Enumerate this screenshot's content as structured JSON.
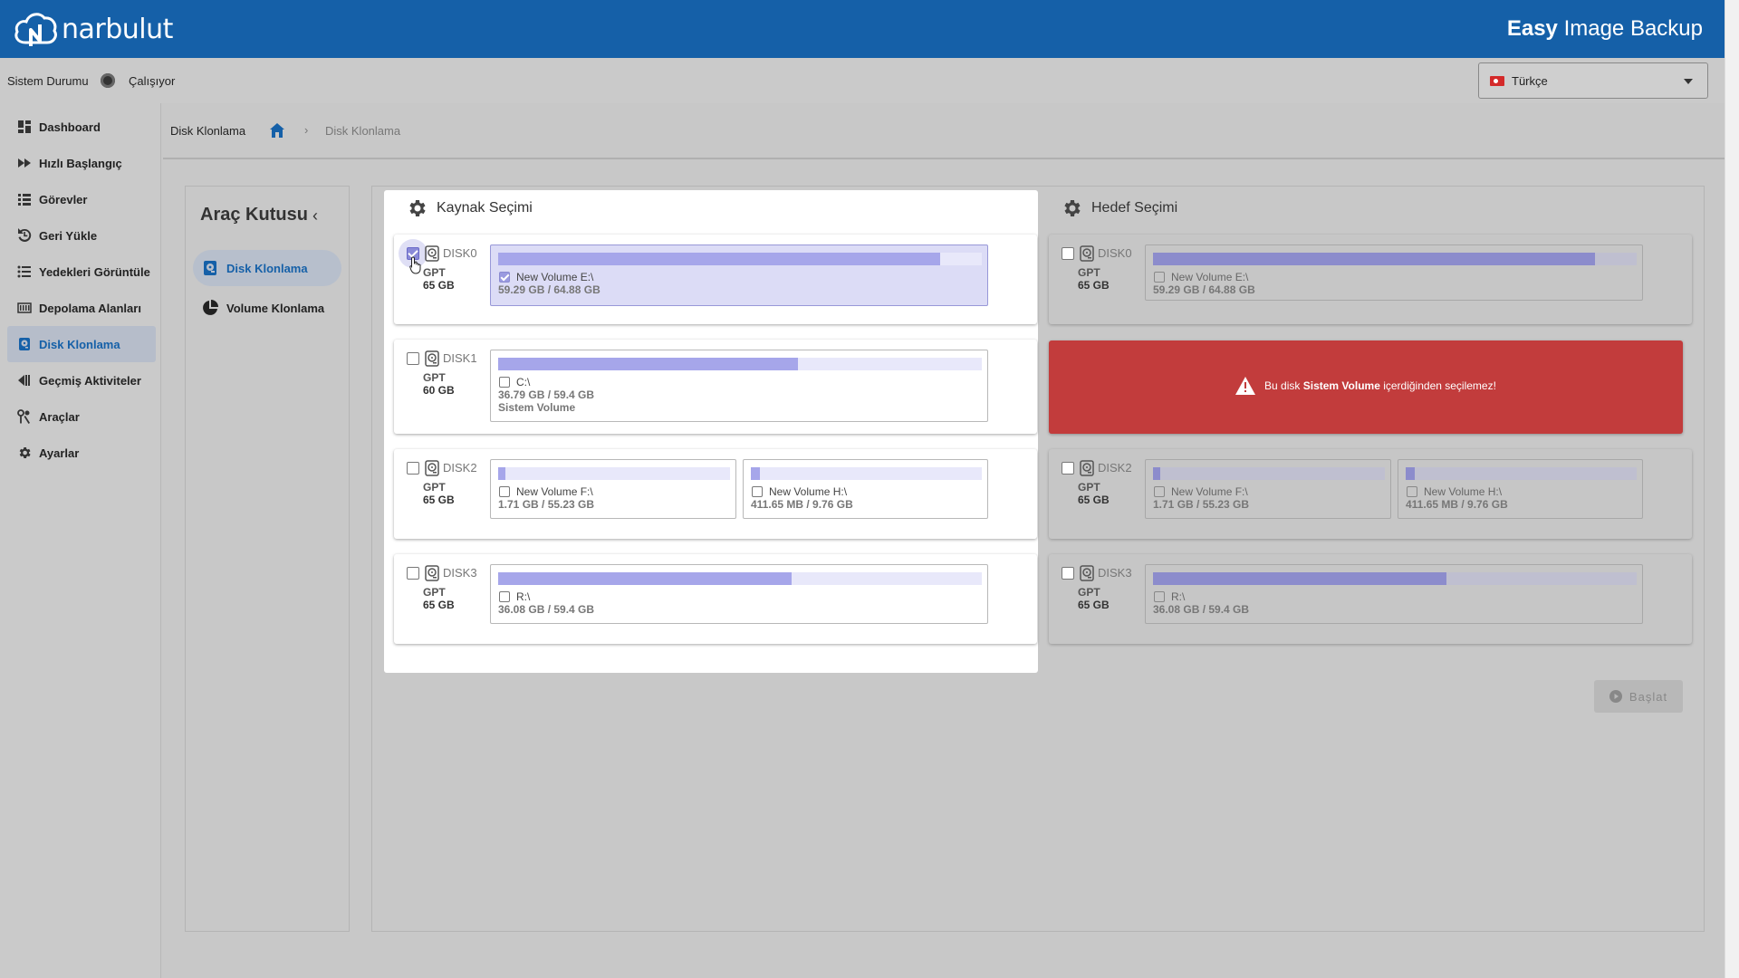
{
  "header": {
    "logo_text": "narbulut",
    "title_bold": "Easy",
    "title_rest": " Image Backup"
  },
  "status": {
    "label": "Sistem Durumu",
    "value": "Çalışıyor"
  },
  "language": {
    "selected": "Türkçe"
  },
  "sidebar": {
    "items": [
      {
        "label": "Dashboard",
        "icon": "dashboard-icon"
      },
      {
        "label": "Hızlı Başlangıç",
        "icon": "fast-forward-icon"
      },
      {
        "label": "Görevler",
        "icon": "list-icon"
      },
      {
        "label": "Geri Yükle",
        "icon": "restore-icon"
      },
      {
        "label": "Yedekleri Görüntüle",
        "icon": "bulleted-list-icon"
      },
      {
        "label": "Depolama Alanları",
        "icon": "storage-icon"
      },
      {
        "label": "Disk Klonlama",
        "icon": "disk-icon",
        "active": true
      },
      {
        "label": "Geçmiş Aktiviteler",
        "icon": "history-icon"
      },
      {
        "label": "Araçlar",
        "icon": "tools-icon"
      },
      {
        "label": "Ayarlar",
        "icon": "gear-icon"
      }
    ]
  },
  "breadcrumb": {
    "title": "Disk Klonlama",
    "current": "Disk Klonlama",
    "separator": "›"
  },
  "toolbox": {
    "title": "Araç Kutusu",
    "items": [
      {
        "label": "Disk Klonlama",
        "active": true
      },
      {
        "label": "Volume Klonlama"
      }
    ]
  },
  "source": {
    "title": "Kaynak Seçimi",
    "disks": [
      {
        "name": "DISK0",
        "part": "GPT",
        "size": "65 GB",
        "checked": true,
        "volumes": [
          {
            "name": "New Volume E:\\",
            "usage": "59.29 GB / 64.88 GB",
            "fill": 0.914,
            "checked": true
          }
        ]
      },
      {
        "name": "DISK1",
        "part": "GPT",
        "size": "60 GB",
        "checked": false,
        "volumes": [
          {
            "name": "C:\\",
            "usage": "36.79 GB / 59.4 GB",
            "extra": "Sistem Volume",
            "fill": 0.619,
            "checked": false
          }
        ]
      },
      {
        "name": "DISK2",
        "part": "GPT",
        "size": "65 GB",
        "checked": false,
        "volumes": [
          {
            "name": "New Volume F:\\",
            "usage": "1.71 GB / 55.23 GB",
            "fill": 0.031,
            "checked": false
          },
          {
            "name": "New Volume H:\\",
            "usage": "411.65 MB / 9.76 GB",
            "fill": 0.041,
            "checked": false
          }
        ]
      },
      {
        "name": "DISK3",
        "part": "GPT",
        "size": "65 GB",
        "checked": false,
        "volumes": [
          {
            "name": "R:\\",
            "usage": "36.08 GB / 59.4 GB",
            "fill": 0.607,
            "checked": false
          }
        ]
      }
    ]
  },
  "target": {
    "title": "Hedef Seçimi",
    "error": {
      "prefix": "Bu disk ",
      "bold": "Sistem Volume",
      "suffix": " içerdiğinden seçilemez!"
    },
    "disks": [
      {
        "name": "DISK0",
        "part": "GPT",
        "size": "65 GB",
        "volumes": [
          {
            "name": "New Volume E:\\",
            "usage": "59.29 GB / 64.88 GB",
            "fill": 0.914
          }
        ]
      },
      {
        "name": "DISK2",
        "part": "GPT",
        "size": "65 GB",
        "volumes": [
          {
            "name": "New Volume F:\\",
            "usage": "1.71 GB / 55.23 GB",
            "fill": 0.031
          },
          {
            "name": "New Volume H:\\",
            "usage": "411.65 MB / 9.76 GB",
            "fill": 0.041
          }
        ]
      },
      {
        "name": "DISK3",
        "part": "GPT",
        "size": "65 GB",
        "volumes": [
          {
            "name": "R:\\",
            "usage": "36.08 GB / 59.4 GB",
            "fill": 0.607
          }
        ]
      }
    ]
  },
  "start_button": {
    "label": "Başlat"
  },
  "colors": {
    "brand": "#1560a8",
    "error": "#c23c3c",
    "bar_fill": "#a6a6ea",
    "bar_track": "#e8e8fa"
  }
}
